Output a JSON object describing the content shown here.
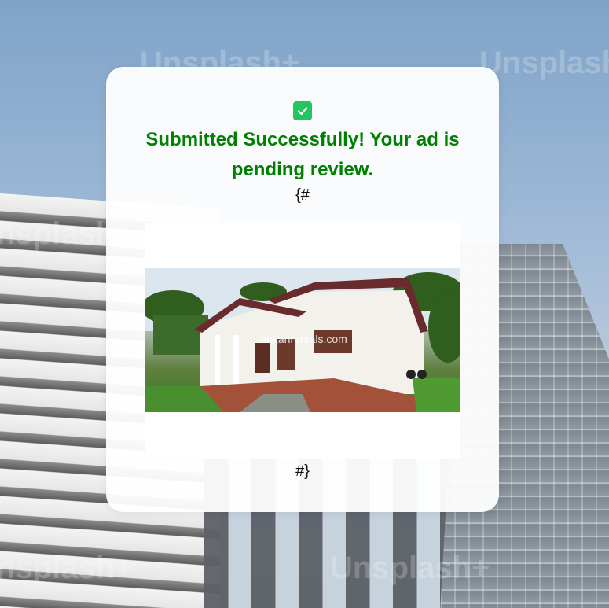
{
  "background": {
    "watermarks": [
      "Unsplash+",
      "Unsplash+",
      "Unsplash+",
      "nsplash+",
      "nsplash+"
    ]
  },
  "card": {
    "status_icon": "check-square-icon",
    "title": "Submitted Successfully! Your ad is pending review.",
    "template_open": "{#",
    "template_close": "#}",
    "image": {
      "watermark": "lankanrentals.com"
    }
  },
  "colors": {
    "success_text": "#008000",
    "check_bg": "#22c55e"
  }
}
